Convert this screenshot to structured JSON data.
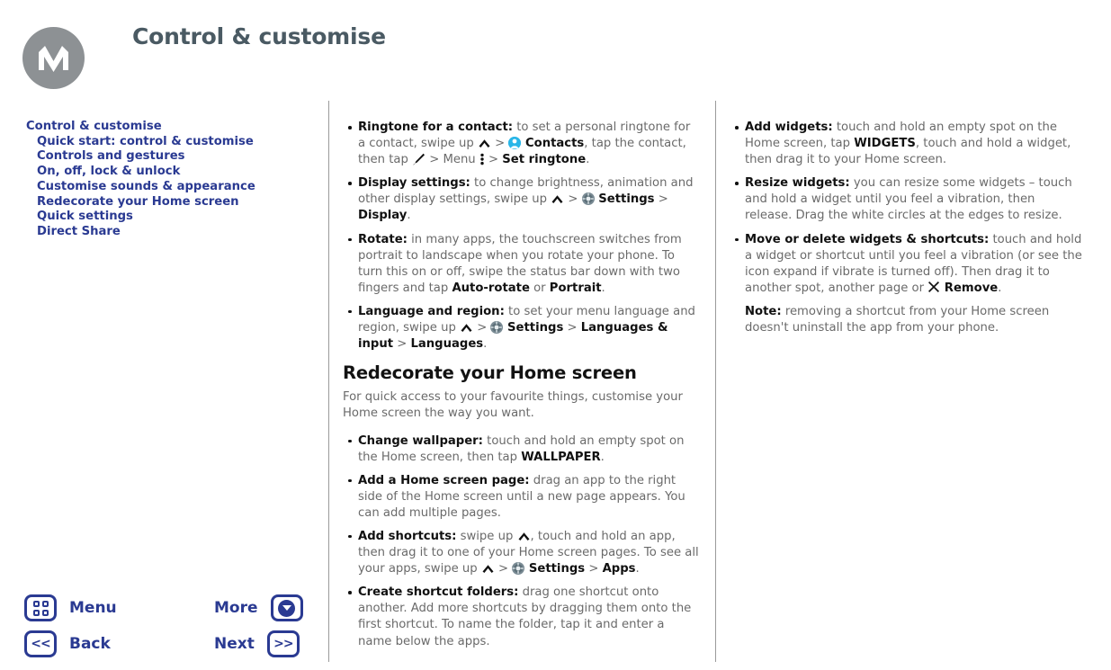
{
  "header": {
    "title": "Control & customise",
    "logo_alt": "motorola-logo"
  },
  "toc": {
    "title": "Control & customise",
    "items": [
      "Quick start: control & customise",
      "Controls and gestures",
      "On, off, lock & unlock",
      "Customise sounds & appearance",
      "Redecorate your Home screen",
      "Quick settings",
      "Direct Share"
    ]
  },
  "middle_column": {
    "bullets": [
      {
        "term": "Ringtone for a contact:",
        "parts": [
          {
            "type": "text",
            "value": " to set a personal ringtone for a contact, swipe up "
          },
          {
            "type": "icon",
            "value": "chevron-up-icon"
          },
          {
            "type": "text",
            "value": " > "
          },
          {
            "type": "icon",
            "value": "contacts-icon"
          },
          {
            "type": "bold",
            "value": " Contacts"
          },
          {
            "type": "text",
            "value": ", tap the contact, then tap "
          },
          {
            "type": "icon",
            "value": "pencil-icon"
          },
          {
            "type": "text",
            "value": " > Menu "
          },
          {
            "type": "icon",
            "value": "overflow-menu-icon"
          },
          {
            "type": "text",
            "value": " > "
          },
          {
            "type": "bold",
            "value": "Set ringtone"
          },
          {
            "type": "text",
            "value": "."
          }
        ]
      },
      {
        "term": "Display settings:",
        "parts": [
          {
            "type": "text",
            "value": " to change brightness, animation and other display settings, swipe up "
          },
          {
            "type": "icon",
            "value": "chevron-up-icon"
          },
          {
            "type": "text",
            "value": " > "
          },
          {
            "type": "icon",
            "value": "settings-gear-icon"
          },
          {
            "type": "bold",
            "value": " Settings"
          },
          {
            "type": "text",
            "value": " > "
          },
          {
            "type": "bold",
            "value": "Display"
          },
          {
            "type": "text",
            "value": "."
          }
        ]
      },
      {
        "term": "Rotate:",
        "parts": [
          {
            "type": "text",
            "value": " in many apps, the touchscreen switches from portrait to landscape when you rotate your phone. To turn this on or off, swipe the status bar down with two fingers and tap "
          },
          {
            "type": "bold",
            "value": "Auto-rotate"
          },
          {
            "type": "text",
            "value": " or "
          },
          {
            "type": "bold",
            "value": "Portrait"
          },
          {
            "type": "text",
            "value": "."
          }
        ]
      },
      {
        "term": "Language and region:",
        "parts": [
          {
            "type": "text",
            "value": " to set your menu language and region, swipe up "
          },
          {
            "type": "icon",
            "value": "chevron-up-icon"
          },
          {
            "type": "text",
            "value": " > "
          },
          {
            "type": "icon",
            "value": "settings-gear-icon"
          },
          {
            "type": "bold",
            "value": " Settings"
          },
          {
            "type": "text",
            "value": " > "
          },
          {
            "type": "bold",
            "value": "Languages & input"
          },
          {
            "type": "text",
            "value": " > "
          },
          {
            "type": "bold",
            "value": "Languages"
          },
          {
            "type": "text",
            "value": "."
          }
        ]
      }
    ],
    "section": {
      "heading": "Redecorate your Home screen",
      "intro": "For quick access to your favourite things, customise your Home screen the way you want.",
      "bullets": [
        {
          "term": "Change wallpaper:",
          "parts": [
            {
              "type": "text",
              "value": " touch and hold an empty spot on the Home screen, then tap "
            },
            {
              "type": "bold",
              "value": "WALLPAPER"
            },
            {
              "type": "text",
              "value": "."
            }
          ]
        },
        {
          "term": "Add a Home screen page:",
          "parts": [
            {
              "type": "text",
              "value": " drag an app to the right side of the Home screen until a new page appears. You can add multiple pages."
            }
          ]
        },
        {
          "term": "Add shortcuts:",
          "parts": [
            {
              "type": "text",
              "value": " swipe up "
            },
            {
              "type": "icon",
              "value": "chevron-up-icon"
            },
            {
              "type": "text",
              "value": ", touch and hold an app, then drag it to one of your Home screen pages. To see all your apps, swipe up "
            },
            {
              "type": "icon",
              "value": "chevron-up-icon"
            },
            {
              "type": "text",
              "value": " > "
            },
            {
              "type": "icon",
              "value": "settings-gear-icon"
            },
            {
              "type": "bold",
              "value": " Settings"
            },
            {
              "type": "text",
              "value": " > "
            },
            {
              "type": "bold",
              "value": "Apps"
            },
            {
              "type": "text",
              "value": "."
            }
          ]
        },
        {
          "term": "Create shortcut folders:",
          "parts": [
            {
              "type": "text",
              "value": " drag one shortcut onto another. Add more shortcuts by dragging them onto the first shortcut. To name the folder, tap it and enter a name below the apps."
            }
          ]
        }
      ]
    }
  },
  "right_column": {
    "bullets": [
      {
        "term": "Add widgets:",
        "parts": [
          {
            "type": "text",
            "value": " touch and hold an empty spot on the Home screen, tap "
          },
          {
            "type": "bold",
            "value": "WIDGETS"
          },
          {
            "type": "text",
            "value": ", touch and hold a widget, then drag it to your Home screen."
          }
        ]
      },
      {
        "term": "Resize widgets:",
        "parts": [
          {
            "type": "text",
            "value": " you can resize some widgets – touch and hold a widget until you feel a vibration, then release. Drag the white circles at the edges to resize."
          }
        ]
      },
      {
        "term": "Move or delete widgets & shortcuts:",
        "parts": [
          {
            "type": "text",
            "value": " touch and hold a widget or shortcut until you feel a vibration (or see the icon expand if vibrate is turned off). Then drag it to another spot, another page or "
          },
          {
            "type": "icon",
            "value": "close-x-icon"
          },
          {
            "type": "bold",
            "value": " Remove"
          },
          {
            "type": "text",
            "value": "."
          }
        ]
      },
      {
        "nobullet": true,
        "term": "Note:",
        "parts": [
          {
            "type": "text",
            "value": " removing a shortcut from your Home screen doesn't uninstall the app from your phone."
          }
        ]
      }
    ]
  },
  "nav": {
    "menu_label": "Menu",
    "back_label": "Back",
    "more_label": "More",
    "next_label": "Next",
    "back_glyph": "<<",
    "next_glyph": ">>"
  },
  "colors": {
    "accent_navy": "#2a3a92",
    "title_slate": "#4a5a63",
    "body_gray": "#6a6a6a",
    "logo_gray": "#8d9194",
    "contacts_blue": "#29b6e8"
  }
}
